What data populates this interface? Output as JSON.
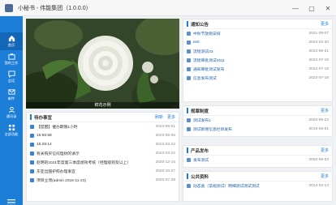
{
  "window": {
    "title": "小秘书 - 伟能集团（1.0.0.0）",
    "controls": [
      "—",
      "▢",
      "✕"
    ]
  },
  "sidebar": {
    "items": [
      {
        "label": "首页",
        "icon": "home-icon"
      },
      {
        "label": "我的工作",
        "icon": "briefcase-icon"
      },
      {
        "label": "会话",
        "icon": "chat-icon"
      },
      {
        "label": "邮件",
        "icon": "mail-icon"
      },
      {
        "label": "通讯录",
        "icon": "contacts-icon"
      },
      {
        "label": "全部功能",
        "icon": "apps-icon"
      }
    ]
  },
  "photo": {
    "caption": "鲜花示例"
  },
  "todo": {
    "title": "待办事宜",
    "refresh": "刷新",
    "more": "更多",
    "items": [
      {
        "text": "【提醒】催办期限1小时",
        "date": "2023-06-01"
      },
      {
        "text": "15:56:58",
        "date": "2023-05-06"
      },
      {
        "text": "15:29:14",
        "date": "2023-03-22"
      },
      {
        "text": "有关购买信托理财的请示",
        "date": "2023-03-22"
      },
      {
        "text": "赵明的2021年度第三季度绩效考核（经理级别及以上）",
        "date": "2020-12-15"
      },
      {
        "text": "东亚出国护照办理事宜",
        "date": "2020-10-27"
      },
      {
        "text": "项目立项(admin 2016-11-23)",
        "date": "2020-07-28"
      }
    ]
  },
  "notices": {
    "title": "通知公告",
    "more": "更多",
    "items": [
      {
        "text": "中秋节放假安排",
        "date": "2021-09-07"
      },
      {
        "text": "test",
        "date": "2023-03-30"
      },
      {
        "text": "流程测试03",
        "date": "2022-09-21"
      },
      {
        "text": "流程审批测试0011",
        "date": "2022-07-19"
      },
      {
        "text": "通知审批测试发布",
        "date": "2022-07-18"
      },
      {
        "text": "信息发布测试",
        "date": "2022-07-18"
      }
    ]
  },
  "rules": {
    "title": "规章制度",
    "more": "更多",
    "items": [
      {
        "text": "测试发布1",
        "date": "2020-09-23"
      },
      {
        "text": "测试新增信息栏目发布",
        "date": "2016-03-01"
      }
    ]
  },
  "products": {
    "title": "产品发布",
    "more": "更多",
    "items": [
      {
        "text": "发布测试",
        "date": "2020-09-23"
      }
    ]
  },
  "publicdocs": {
    "title": "公共资料",
    "more": "更多",
    "items": [
      {
        "text": "动态类（常规测试）明细测试测试测试",
        "date": "2014-03-14"
      }
    ]
  }
}
